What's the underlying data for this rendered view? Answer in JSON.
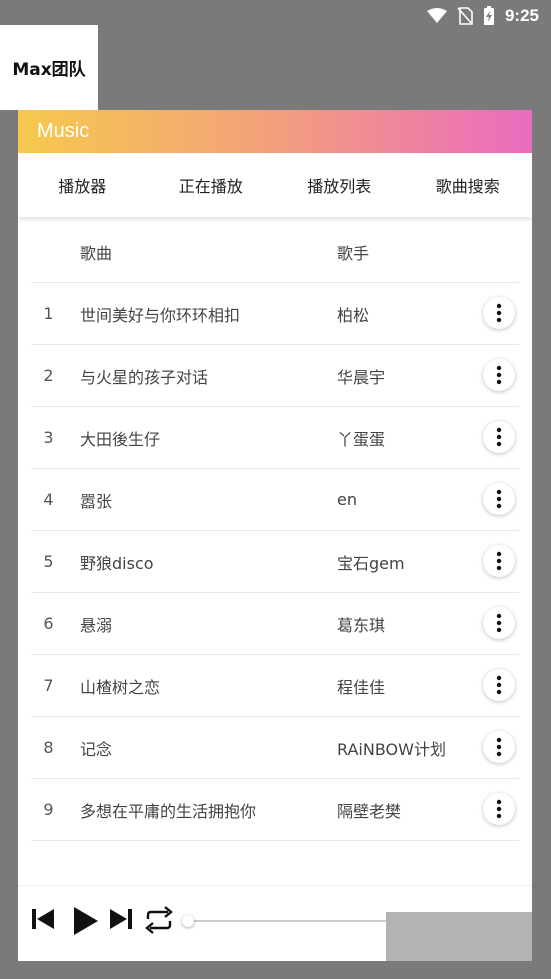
{
  "status_bar": {
    "time": "9:25"
  },
  "logo": {
    "text": "Max团队"
  },
  "app": {
    "title": "Music"
  },
  "tabs": [
    {
      "label": "播放器"
    },
    {
      "label": "正在播放"
    },
    {
      "label": "播放列表"
    },
    {
      "label": "歌曲搜索"
    }
  ],
  "table": {
    "headers": {
      "song": "歌曲",
      "artist": "歌手"
    },
    "rows": [
      {
        "num": "1",
        "song": "世间美好与你环环相扣",
        "artist": "柏松"
      },
      {
        "num": "2",
        "song": "与火星的孩子对话",
        "artist": "华晨宇"
      },
      {
        "num": "3",
        "song": "大田後生仔",
        "artist": "丫蛋蛋"
      },
      {
        "num": "4",
        "song": "嚣张",
        "artist": "en"
      },
      {
        "num": "5",
        "song": "野狼disco",
        "artist": "宝石gem"
      },
      {
        "num": "6",
        "song": "悬溺",
        "artist": "葛东琪"
      },
      {
        "num": "7",
        "song": "山楂树之恋",
        "artist": "程佳佳"
      },
      {
        "num": "8",
        "song": "记念",
        "artist": "RAiNBOW计划"
      },
      {
        "num": "9",
        "song": "多想在平庸的生活拥抱你",
        "artist": "隔壁老樊"
      }
    ]
  },
  "player": {
    "progress": 0.0
  },
  "colors": {
    "header_gradient_start": "#f6c94d",
    "header_gradient_end": "#ea6cc0",
    "backdrop": "#7a7a7a"
  }
}
